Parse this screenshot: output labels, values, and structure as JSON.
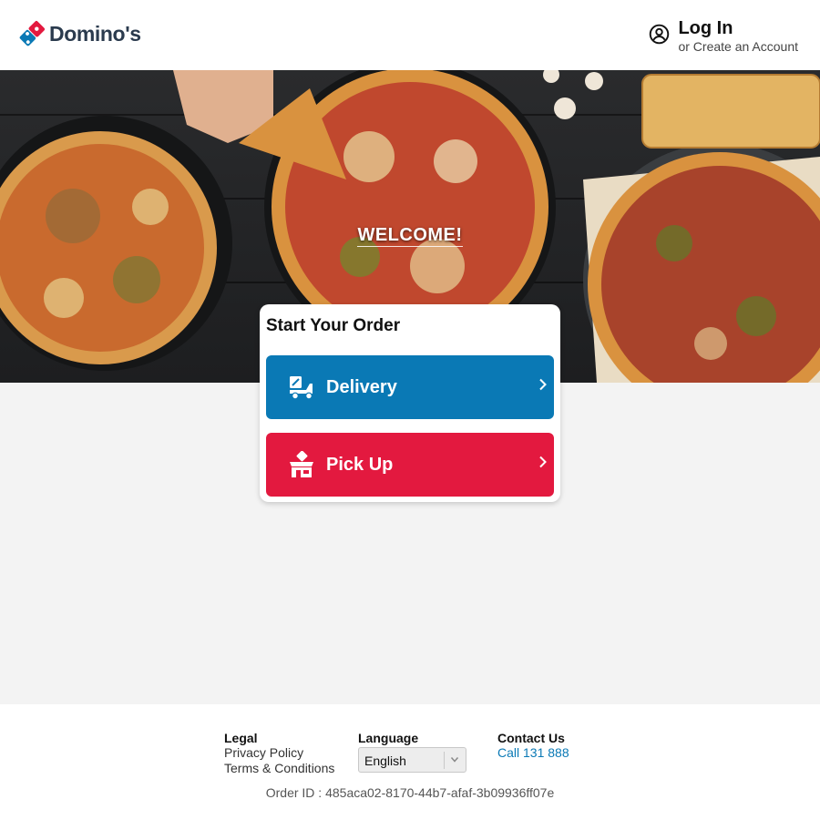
{
  "header": {
    "brand": "Domino's",
    "login_label": "Log In",
    "create_account_label": "or Create an Account"
  },
  "hero": {
    "welcome": "WELCOME!"
  },
  "order": {
    "title": "Start Your Order",
    "options": [
      {
        "label": "Delivery",
        "icon": "delivery-scooter-icon",
        "color": "#0a79b5"
      },
      {
        "label": "Pick Up",
        "icon": "store-pickup-icon",
        "color": "#e3193f"
      }
    ]
  },
  "footer": {
    "legal": {
      "heading": "Legal",
      "links": [
        "Privacy Policy",
        "Terms & Conditions"
      ]
    },
    "language": {
      "heading": "Language",
      "selected": "English"
    },
    "contact": {
      "heading": "Contact Us",
      "phone": "Call 131 888"
    },
    "order_id": "Order ID : 485aca02-8170-44b7-afaf-3b09936ff07e"
  },
  "colors": {
    "brand_blue": "#0a79b5",
    "brand_red": "#e3193f",
    "page_bg": "#f3f3f3"
  }
}
